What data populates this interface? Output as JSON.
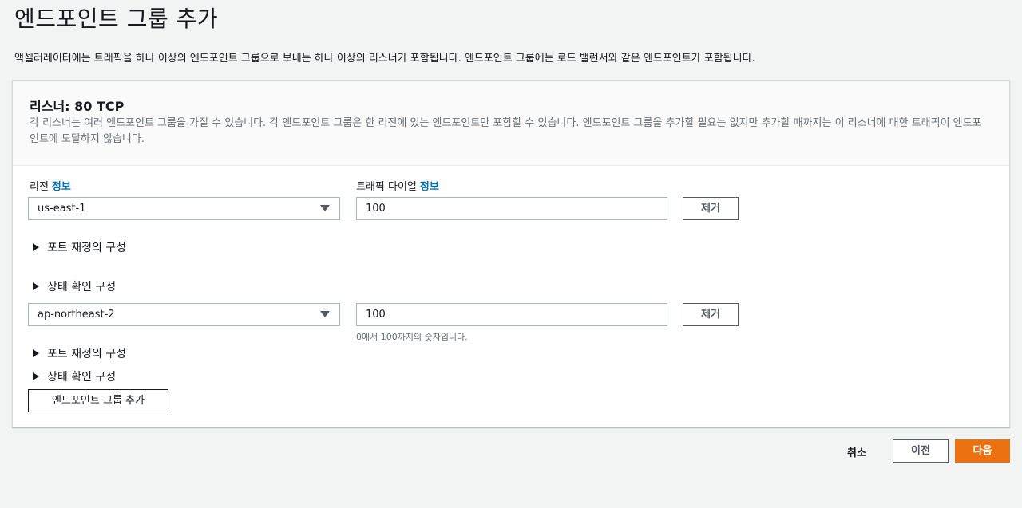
{
  "page": {
    "title": "엔드포인트 그룹 추가",
    "description": "액셀러레이터에는 트래픽을 하나 이상의 엔드포인트 그룹으로 보내는 하나 이상의 리스너가 포함됩니다. 엔드포인트 그룹에는 로드 밸런서와 같은 엔드포인트가 포함됩니다."
  },
  "listener": {
    "title": "리스너: 80 TCP",
    "description": "각 리스너는 여러 엔드포인트 그룹을 가질 수 있습니다. 각 엔드포인트 그룹은 한 리전에 있는 엔드포인트만 포함할 수 있습니다. 엔드포인트 그룹을 추가할 필요는 없지만 추가할 때까지는 이 리스너에 대한 트래픽이 엔드포인트에 도달하지 않습니다."
  },
  "labels": {
    "region": "리전",
    "traffic_dial": "트래픽 다이얼",
    "info": "정보"
  },
  "groups": [
    {
      "region": "us-east-1",
      "traffic_dial": "100",
      "remove_label": "제거",
      "port_override": "포트 재정의 구성",
      "health_check": "상태 확인 구성"
    },
    {
      "region": "ap-northeast-2",
      "traffic_dial": "100",
      "hint": "0에서 100까지의 숫자입니다.",
      "remove_label": "제거",
      "port_override": "포트 재정의 구성",
      "health_check": "상태 확인 구성"
    }
  ],
  "add_group_label": "엔드포인트 그룹 추가",
  "footer": {
    "cancel": "취소",
    "previous": "이전",
    "next": "다음"
  },
  "colors": {
    "primary": "#ec7211",
    "link": "#0073bb"
  }
}
